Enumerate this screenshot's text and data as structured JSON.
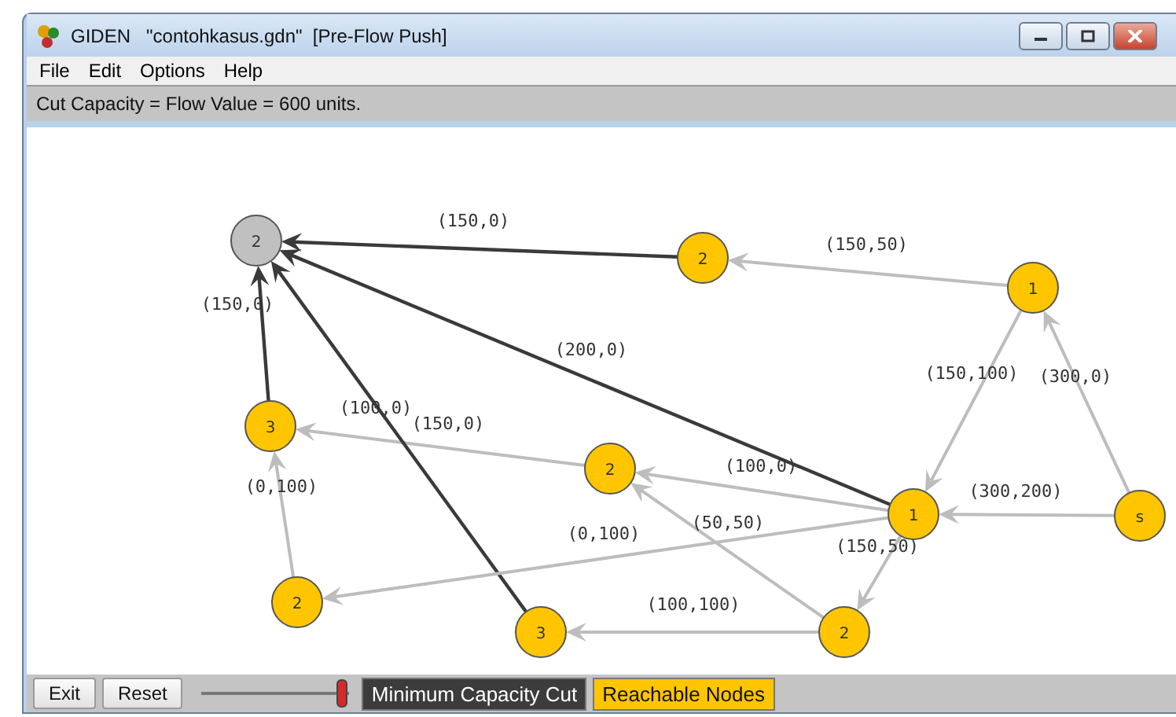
{
  "window": {
    "title": "GIDEN   \"contohkasus.gdn\"  [Pre-Flow Push]"
  },
  "menu": [
    "File",
    "Edit",
    "Options",
    "Help"
  ],
  "status": "Cut Capacity = Flow Value = 600 units.",
  "graph": {
    "nodes": [
      {
        "label": "2",
        "color": "#c0c0c0"
      },
      {
        "label": "2",
        "color": "#ffc600"
      },
      {
        "label": "1",
        "color": "#ffc600"
      },
      {
        "label": "3",
        "color": "#ffc600"
      },
      {
        "label": "2",
        "color": "#ffc600"
      },
      {
        "label": "1",
        "color": "#ffc600"
      },
      {
        "label": "s",
        "color": "#ffc600"
      },
      {
        "label": "2",
        "color": "#ffc600"
      },
      {
        "label": "3",
        "color": "#ffc600"
      },
      {
        "label": "2",
        "color": "#ffc600"
      }
    ],
    "edges": [
      {
        "label": "(150,0)",
        "in_cut": true
      },
      {
        "label": "(150,50)",
        "in_cut": false
      },
      {
        "label": "(200,0)",
        "in_cut": true
      },
      {
        "label": "(150,100)",
        "in_cut": false
      },
      {
        "label": "(300,0)",
        "in_cut": false
      },
      {
        "label": "(150,0)",
        "in_cut": true
      },
      {
        "label": "(150,0)",
        "in_cut": false
      },
      {
        "label": "(100,0)",
        "in_cut": true
      },
      {
        "label": "(100,0)",
        "in_cut": false
      },
      {
        "label": "(0,100)",
        "in_cut": false
      },
      {
        "label": "(300,200)",
        "in_cut": false
      },
      {
        "label": "(0,100)",
        "in_cut": false
      },
      {
        "label": "(50,50)",
        "in_cut": false
      },
      {
        "label": "(150,50)",
        "in_cut": false
      },
      {
        "label": "(100,100)",
        "in_cut": false
      }
    ]
  },
  "controls": {
    "buttons": [
      "Exit",
      "Reset"
    ],
    "slider": {
      "level": 1
    },
    "toggles": [
      {
        "label": "Minimum Capacity Cut",
        "kind": "cut"
      },
      {
        "label": "Reachable Nodes",
        "kind": "reachable"
      }
    ]
  }
}
